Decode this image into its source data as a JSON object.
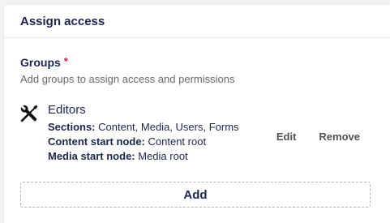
{
  "panel": {
    "title": "Assign access"
  },
  "groups_field": {
    "label": "Groups",
    "required_mark": "*",
    "description": "Add groups to assign access and permissions",
    "items": [
      {
        "icon": "tools-icon",
        "name": "Editors",
        "sections_label": "Sections:",
        "sections_value": "Content, Media, Users, Forms",
        "content_start_label": "Content start node:",
        "content_start_value": "Content root",
        "media_start_label": "Media start node:",
        "media_start_value": "Media root",
        "edit_label": "Edit",
        "remove_label": "Remove"
      }
    ],
    "add_label": "Add"
  },
  "colors": {
    "text": "#1b264f",
    "required": "#d42054",
    "muted": "#68676b"
  }
}
